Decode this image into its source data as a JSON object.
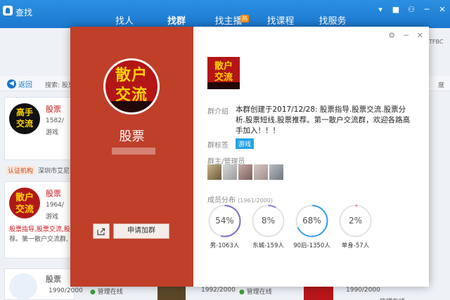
{
  "app": {
    "title": "查找"
  },
  "nav": [
    {
      "label": "找人",
      "active": false
    },
    {
      "label": "找群",
      "active": true
    },
    {
      "label": "找主播",
      "active": false,
      "badge": "热"
    },
    {
      "label": "找课程",
      "active": false
    },
    {
      "label": "找服务",
      "active": false
    }
  ],
  "window_controls": [
    "▾",
    "■",
    "⚇",
    "─",
    "✕"
  ],
  "background": {
    "back_label": "返回",
    "search_prefix": "搜索: 股票",
    "right_text_1": "TFBC",
    "right_text_2": "度",
    "cards": [
      {
        "name": "股票",
        "members": "1582/",
        "tag": "游戏"
      },
      {
        "name": "股票",
        "members": "1964/",
        "desc_1": "股票指导,股票交流,股",
        "desc_2": "荐。第一散户交流群,",
        "tag": "游戏"
      },
      {
        "name": "股票",
        "members": "1990/2000",
        "status": "管理在线"
      },
      {
        "members": "1992/2000",
        "status": "管理在线"
      },
      {
        "members": "1990/2000",
        "status": "管理在线"
      }
    ],
    "cert_label": "认证机构",
    "cert_org": "深圳市艾尼"
  },
  "dialog": {
    "group_name": "股票",
    "logo_text": [
      "散户",
      "交流"
    ],
    "share_icon": "share-icon",
    "join_label": "申请加群",
    "intro_label": "群介绍",
    "intro_text": "本群创建于2017/12/28: 股票指导.股票交流.股票分析.股票短线.股票推荐。第一散户交流群，欢迎各路高手加入！！！",
    "tags_label": "群标签",
    "tag": "游戏",
    "owner_label": "群主/管理员",
    "distribution_label": "成员分布",
    "distribution_count": "(1961/2000)",
    "stats": [
      {
        "value": "54%",
        "label": "男-1063人",
        "fraction": 0.54,
        "color": "#7a6fd4"
      },
      {
        "value": "8%",
        "label": "东城-159人",
        "fraction": 0.08,
        "color": "#8c7ad8"
      },
      {
        "value": "68%",
        "label": "90后-1350人",
        "fraction": 0.68,
        "color": "#3aa0e8"
      },
      {
        "value": "2%",
        "label": "单身-57人",
        "fraction": 0.02,
        "color": "#e66f8e"
      }
    ],
    "controls": [
      "⚙",
      "─",
      "✕"
    ]
  },
  "colors": {
    "brand_blue": "#1a78cf",
    "panel_red": "#bf3f29",
    "tag_blue": "#23a3e6"
  }
}
